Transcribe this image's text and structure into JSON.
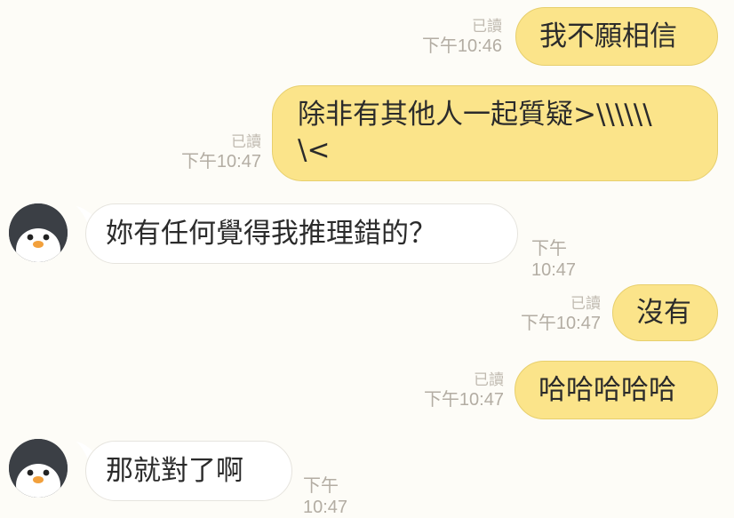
{
  "messages": [
    {
      "id": "m1",
      "dir": "out",
      "text": "我不願相信",
      "read": "已讀",
      "time": "下午10:46"
    },
    {
      "id": "m2",
      "dir": "out",
      "text": "除非有其他人一起質疑>\\\\\\\\\\\\\n\\<",
      "read": "已讀",
      "time": "下午10:47"
    },
    {
      "id": "m3",
      "dir": "in",
      "text": "妳有任何覺得我推理錯的？",
      "time": "下午10:47"
    },
    {
      "id": "m4",
      "dir": "out",
      "text": "沒有",
      "read": "已讀",
      "time": "下午10:47"
    },
    {
      "id": "m5",
      "dir": "out",
      "text": "哈哈哈哈哈",
      "read": "已讀",
      "time": "下午10:47"
    },
    {
      "id": "m6",
      "dir": "in",
      "text": "那就對了啊",
      "time": "下午10:47"
    }
  ],
  "colors": {
    "background": "#fdfcf7",
    "outgoing_bubble": "#fbe48a",
    "incoming_bubble": "#ffffff",
    "timestamp": "#b3ada3"
  },
  "avatar_icon": "penguin-icon"
}
